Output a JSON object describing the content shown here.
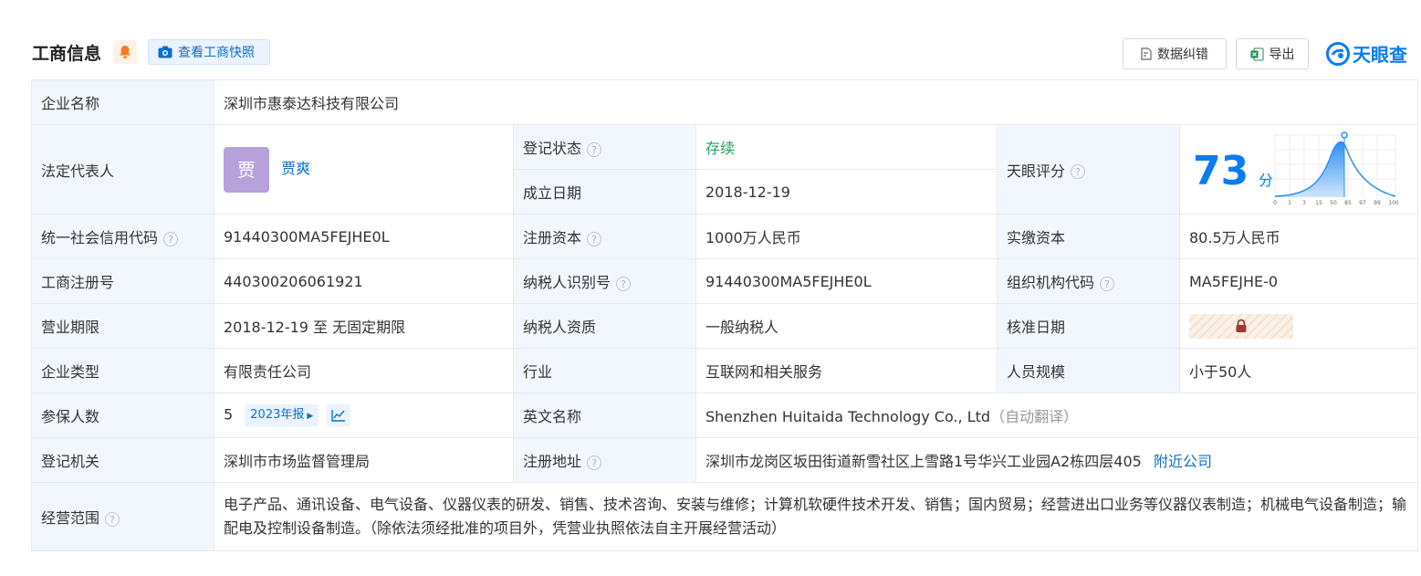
{
  "header": {
    "title": "工商信息",
    "snapshot_label": "查看工商快照",
    "error_label": "数据纠错",
    "export_label": "导出",
    "brand": "天眼查"
  },
  "rows": {
    "company_name_label": "企业名称",
    "company_name": "深圳市惠泰达科技有限公司",
    "legal_rep_label": "法定代表人",
    "legal_rep_avatar": "贾",
    "legal_rep": "贾爽",
    "reg_status_label": "登记状态",
    "reg_status": "存续",
    "found_date_label": "成立日期",
    "found_date": "2018-12-19",
    "tianyan_score_label": "天眼评分",
    "tianyan_score": "73",
    "score_unit": "分",
    "score_ticks": [
      "0",
      "1",
      "3",
      "15",
      "50",
      "85",
      "97",
      "99",
      "100"
    ],
    "credit_code_label": "统一社会信用代码",
    "credit_code": "91440300MA5FEJHE0L",
    "reg_capital_label": "注册资本",
    "reg_capital": "1000万人民币",
    "paid_capital_label": "实缴资本",
    "paid_capital": "80.5万人民币",
    "biz_reg_no_label": "工商注册号",
    "biz_reg_no": "440300206061921",
    "taxpayer_id_label": "纳税人识别号",
    "taxpayer_id": "91440300MA5FEJHE0L",
    "org_code_label": "组织机构代码",
    "org_code": "MA5FEJHE-0",
    "term_label": "营业期限",
    "term": "2018-12-19 至 无固定期限",
    "taxpayer_qual_label": "纳税人资质",
    "taxpayer_qual": "一般纳税人",
    "approve_date_label": "核准日期",
    "company_type_label": "企业类型",
    "company_type": "有限责任公司",
    "industry_label": "行业",
    "industry": "互联网和相关服务",
    "staff_size_label": "人员规模",
    "staff_size": "小于50人",
    "insured_label": "参保人数",
    "insured": "5",
    "insured_year": "2023年报",
    "english_name_label": "英文名称",
    "english_name": "Shenzhen Huitaida Technology Co., Ltd",
    "english_auto": "（自动翻译）",
    "reg_authority_label": "登记机关",
    "reg_authority": "深圳市市场监督管理局",
    "reg_address_label": "注册地址",
    "reg_address": "深圳市龙岗区坂田街道新雪社区上雪路1号华兴工业园A2栋四层405",
    "nearby": "附近公司",
    "scope_label": "经营范围",
    "scope": "电子产品、通讯设备、电气设备、仪器仪表的研发、销售、技术咨询、安装与维修；计算机软硬件技术开发、销售；国内贸易；经营进出口业务等仪器仪表制造；机械电气设备制造；输配电及控制设备制造。（除依法须经批准的项目外，凭营业执照依法自主开展经营活动）"
  },
  "colors": {
    "accent": "#0a7cf0",
    "label_bg": "#f2f7fd",
    "status_green": "#1aa553"
  }
}
